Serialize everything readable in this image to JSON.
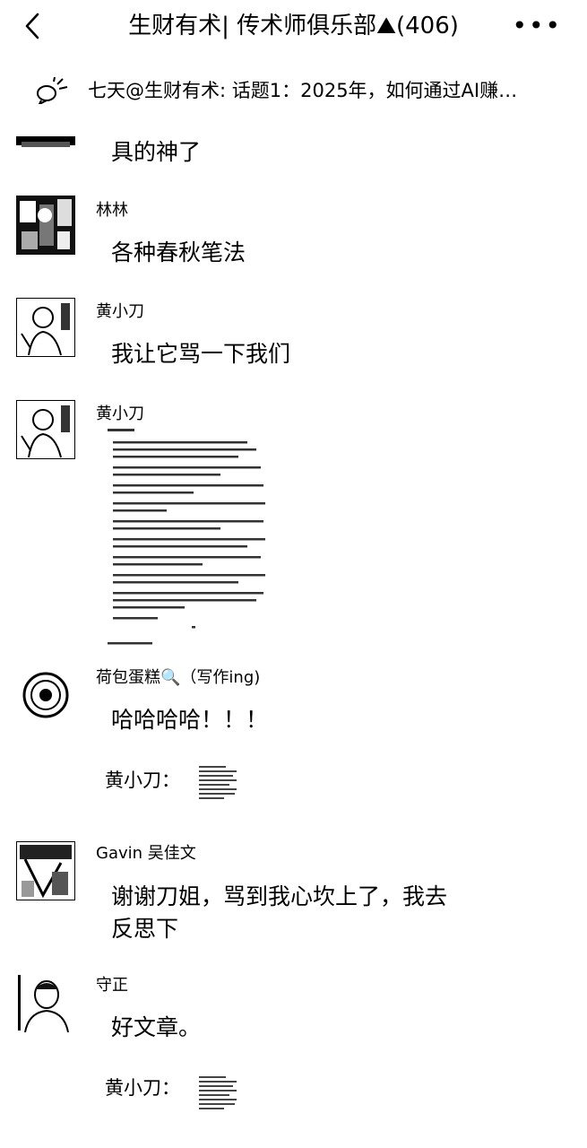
{
  "header": {
    "title": "生财有术| 传术师俱乐部⛰(406)",
    "back_icon": "chevron-left-icon",
    "more_icon": "more-horizontal-icon"
  },
  "pinned": {
    "icon": "megaphone-icon",
    "text": "七天@生财有术: 话题1：2025年，如何通过AI赚…"
  },
  "messages": [
    {
      "text": "具的神了"
    },
    {
      "name": "林林",
      "text": "各种春秋笔法"
    },
    {
      "name": "黄小刀",
      "text": "我让它骂一下我们"
    },
    {
      "name": "黄小刀",
      "image": "screenshot of document text"
    },
    {
      "name": "荷包蛋糕🔍（写作ing)",
      "text": "哈哈哈哈！！！",
      "quote": "黄小刀："
    },
    {
      "name": "Gavin 吴佳文",
      "text_line1": "谢谢刀姐，骂到我心坎上了，我去",
      "text_line2": "反思下"
    },
    {
      "name": "守正",
      "text": "好文章。",
      "quote": "黄小刀："
    }
  ]
}
